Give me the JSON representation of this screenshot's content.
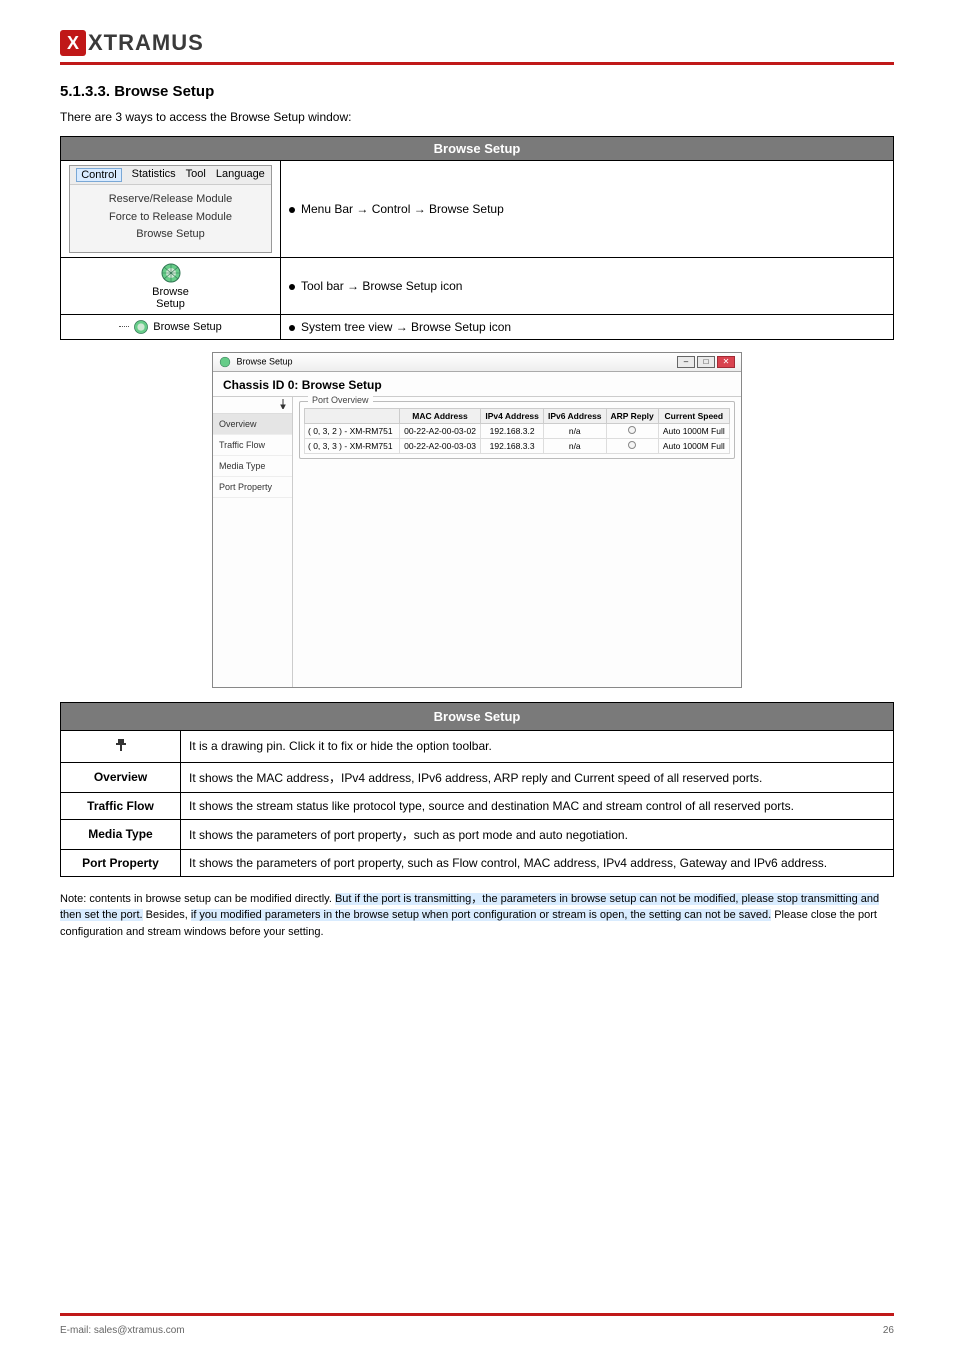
{
  "brand": "XTRAMUS",
  "section": {
    "number": "5.1.3.3. Browse Setup",
    "intro": "There are 3 ways to access the Browse Setup window:"
  },
  "access_table": {
    "header": "Browse Setup",
    "rows": [
      {
        "menu_bar": [
          "Control",
          "Statistics",
          "Tool",
          "Language"
        ],
        "menu_items": [
          "Reserve/Release Module",
          "Force to Release Module",
          "Browse Setup"
        ],
        "desc": "Menu Bar → Control → Browse Setup"
      },
      {
        "label": "Browse Setup",
        "desc": "Tool bar → Browse Setup icon"
      },
      {
        "label": "Browse Setup",
        "desc": "System tree view → Browse Setup icon"
      }
    ]
  },
  "window": {
    "title": "Browse Setup",
    "heading": "Chassis ID 0: Browse Setup",
    "nav": [
      "Overview",
      "Traffic Flow",
      "Media Type",
      "Port Property"
    ],
    "group": "Port Overview",
    "columns": [
      "",
      "MAC Address",
      "IPv4 Address",
      "IPv6 Address",
      "ARP Reply",
      "Current Speed"
    ],
    "rows": [
      {
        "port": "( 0, 3, 2 ) - XM-RM751",
        "mac": "00-22-A2-00-03-02",
        "ipv4": "192.168.3.2",
        "ipv6": "n/a",
        "speed": "Auto 1000M Full"
      },
      {
        "port": "( 0, 3, 3 ) - XM-RM751",
        "mac": "00-22-A2-00-03-03",
        "ipv4": "192.168.3.3",
        "ipv6": "n/a",
        "speed": "Auto 1000M Full"
      }
    ]
  },
  "options": {
    "header": "Browse Setup",
    "rows": [
      {
        "label_img": "pin",
        "desc": "It is a drawing pin. Click it to fix or hide the option toolbar."
      },
      {
        "label": "Overview",
        "desc": "It shows the MAC address，IPv4 address, IPv6 address, ARP reply and Current speed of all reserved ports."
      },
      {
        "label": "Traffic Flow",
        "desc": "It shows the stream status like protocol type, source and destination MAC and stream control of all reserved ports."
      },
      {
        "label": "Media Type",
        "desc": "It shows the parameters of port property，such as port mode and auto negotiation."
      },
      {
        "label": "Port Property",
        "desc": "It shows the parameters of port property, such as Flow control, MAC address, IPv4 address, Gateway and IPv6 address."
      }
    ]
  },
  "note": {
    "prefix": "Note: contents in browse setup can be modified directly. ",
    "hl1": "But if the port is transmitting，the parameters in browse setup can not be modified, please stop transmitting and then set the port.",
    "mid": " Besides, ",
    "hl2": "if you modified parameters in the browse setup when port configuration or stream is open, the setting can not be saved.",
    "suffix": " Please close the port configuration and stream windows before your setting."
  },
  "footer": {
    "left": "E-mail: sales@xtramus.com",
    "right": "26"
  }
}
